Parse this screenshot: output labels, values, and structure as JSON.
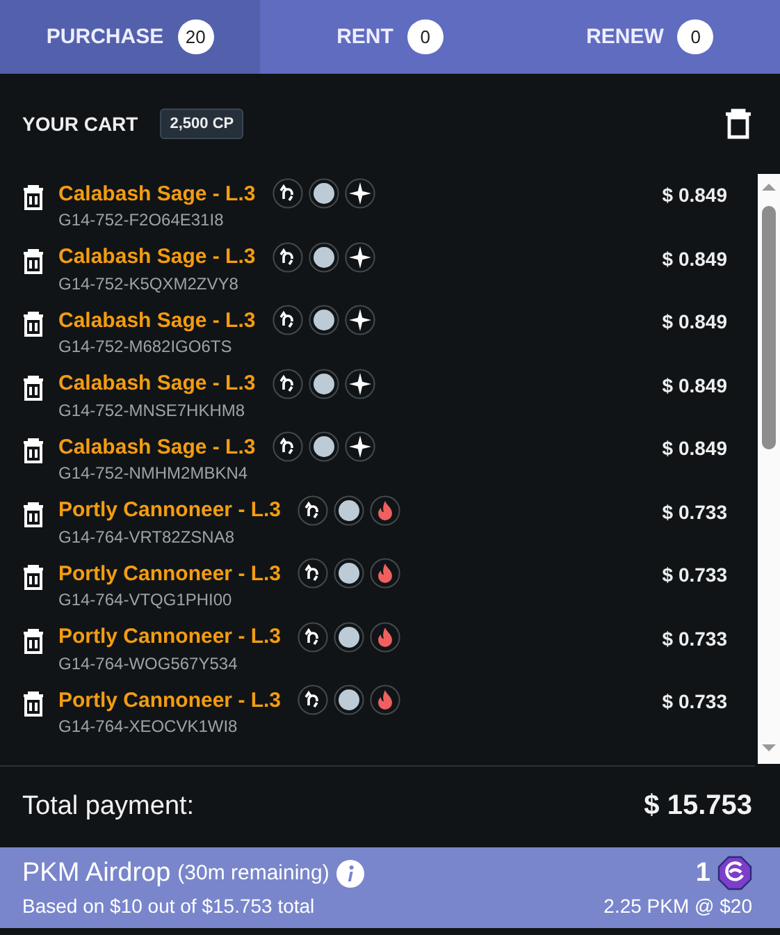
{
  "tabs": [
    {
      "label": "PURCHASE",
      "count": "20",
      "selected": true
    },
    {
      "label": "RENT",
      "count": "0",
      "selected": false
    },
    {
      "label": "RENEW",
      "count": "0",
      "selected": false
    }
  ],
  "cart": {
    "title": "YOUR CART",
    "points": "2,500 CP"
  },
  "items": [
    {
      "name": "Calabash Sage - L.3",
      "code": "G14-752-F2O64E31I8",
      "price": "$ 0.849",
      "kind": "light"
    },
    {
      "name": "Calabash Sage - L.3",
      "code": "G14-752-K5QXM2ZVY8",
      "price": "$ 0.849",
      "kind": "light"
    },
    {
      "name": "Calabash Sage - L.3",
      "code": "G14-752-M682IGO6TS",
      "price": "$ 0.849",
      "kind": "light"
    },
    {
      "name": "Calabash Sage - L.3",
      "code": "G14-752-MNSE7HKHM8",
      "price": "$ 0.849",
      "kind": "light"
    },
    {
      "name": "Calabash Sage - L.3",
      "code": "G14-752-NMHM2MBKN4",
      "price": "$ 0.849",
      "kind": "light"
    },
    {
      "name": "Portly Cannoneer - L.3",
      "code": "G14-764-VRT82ZSNA8",
      "price": "$ 0.733",
      "kind": "fire"
    },
    {
      "name": "Portly Cannoneer - L.3",
      "code": "G14-764-VTQG1PHI00",
      "price": "$ 0.733",
      "kind": "fire"
    },
    {
      "name": "Portly Cannoneer - L.3",
      "code": "G14-764-WOG567Y534",
      "price": "$ 0.733",
      "kind": "fire"
    },
    {
      "name": "Portly Cannoneer - L.3",
      "code": "G14-764-XEOCVK1WI8",
      "price": "$ 0.733",
      "kind": "fire"
    }
  ],
  "total": {
    "label": "Total payment:",
    "amount": "$ 15.753"
  },
  "airdrop": {
    "title": "PKM Airdrop",
    "remaining": "(30m remaining)",
    "count": "1",
    "basis": "Based on $10 out of $15.753 total",
    "rate": "2.25 PKM @ $20"
  }
}
